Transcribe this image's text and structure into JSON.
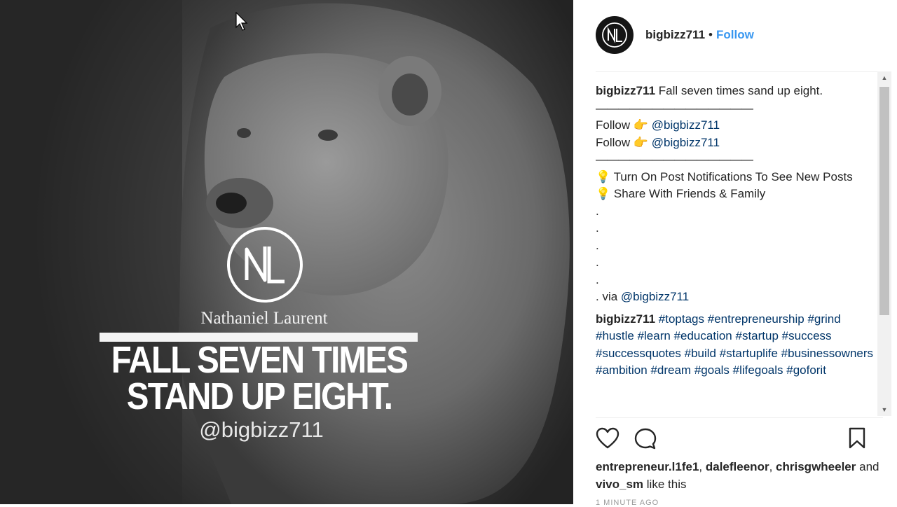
{
  "post": {
    "logo_text": "NL",
    "brand_name": "Nathaniel Laurent",
    "headline_line1": "FALL SEVEN TIMES",
    "headline_line2": "STAND UP EIGHT.",
    "handle": "@bigbizz711"
  },
  "header": {
    "username": "bigbizz711",
    "separator": "•",
    "follow_label": "Follow"
  },
  "caption": {
    "username": "bigbizz711",
    "text": "Fall seven times sand up eight.",
    "rule": "——————————————",
    "follow_word": "Follow",
    "follow_emoji": "👉",
    "follow_handle": "@bigbizz711",
    "bulb_emoji": "💡",
    "notify_text": "Turn On Post Notifications To See New Posts",
    "share_text": "Share With Friends & Family",
    "dot": ".",
    "via_prefix": ". via",
    "via_handle": "@bigbizz711"
  },
  "tags_comment": {
    "username": "bigbizz711",
    "hashtags": [
      "#toptags",
      "#entrepreneurship",
      "#grind",
      "#hustle",
      "#learn",
      "#education",
      "#startup",
      "#success",
      "#successquotes",
      "#build",
      "#startuplife",
      "#businessowners",
      "#ambition",
      "#dream",
      "#goals",
      "#lifegoals",
      "#goforit"
    ]
  },
  "actions": {
    "like_icon": "heart-outline",
    "comment_icon": "speech-bubble",
    "save_icon": "bookmark"
  },
  "likes": {
    "users": [
      "entrepreneur.l1fe1",
      "dalefleenor",
      "chrisgwheeler",
      "vivo_sm"
    ],
    "comma": ",",
    "and_word": "and",
    "suffix": "like this"
  },
  "time_ago": "1 MINUTE AGO",
  "scrollbar": {
    "up_glyph": "▲",
    "down_glyph": "▼"
  },
  "colors": {
    "follow": "#3897f0",
    "link": "#003569",
    "text": "#262626"
  }
}
